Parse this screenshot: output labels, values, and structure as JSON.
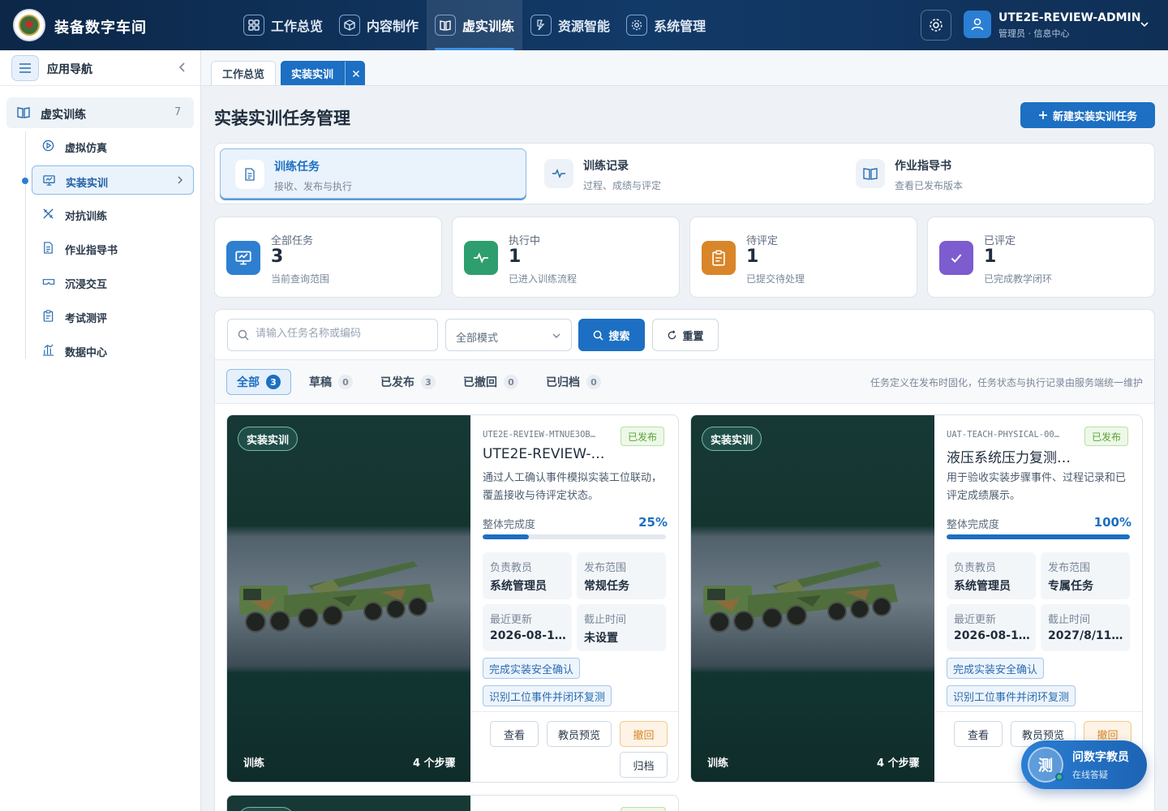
{
  "app": {
    "title": "装备数字车间"
  },
  "top_nav": [
    {
      "label": "工作总览",
      "icon": "grid-icon"
    },
    {
      "label": "内容制作",
      "icon": "cube-icon"
    },
    {
      "label": "虚实训练",
      "icon": "book-icon",
      "active": true
    },
    {
      "label": "资源智能",
      "icon": "magnet-icon"
    },
    {
      "label": "系统管理",
      "icon": "gear-icon"
    }
  ],
  "user": {
    "name": "UTE2E-REVIEW-ADMIN",
    "role": "管理员 · 信息中心"
  },
  "sidebar": {
    "title": "应用导航",
    "group": {
      "label": "虚实训练",
      "count": "7"
    },
    "items": [
      {
        "label": "虚拟仿真",
        "icon": "play-circle-icon"
      },
      {
        "label": "实装实训",
        "icon": "monitor-icon",
        "active": true
      },
      {
        "label": "对抗训练",
        "icon": "versus-icon"
      },
      {
        "label": "作业指导书",
        "icon": "document-icon"
      },
      {
        "label": "沉浸交互",
        "icon": "vr-glasses-icon"
      },
      {
        "label": "考试测评",
        "icon": "clipboard-icon"
      },
      {
        "label": "数据中心",
        "icon": "bar-chart-icon"
      }
    ]
  },
  "tabs": [
    {
      "label": "工作总览"
    },
    {
      "label": "实装实训",
      "active": true
    }
  ],
  "page": {
    "title": "实装实训任务管理",
    "new_button": "新建实装实训任务"
  },
  "modes": [
    {
      "title": "训练任务",
      "subtitle": "接收、发布与执行",
      "icon": "document-icon",
      "active": true
    },
    {
      "title": "训练记录",
      "subtitle": "过程、成绩与评定",
      "icon": "pulse-icon"
    },
    {
      "title": "作业指导书",
      "subtitle": "查看已发布版本",
      "icon": "book-icon"
    }
  ],
  "stats": [
    {
      "label": "全部任务",
      "value": "3",
      "sub": "当前查询范围",
      "color": "#2f7fd0",
      "icon": "monitor-icon"
    },
    {
      "label": "执行中",
      "value": "1",
      "sub": "已进入训练流程",
      "color": "#2e9e6e",
      "icon": "pulse-icon"
    },
    {
      "label": "待评定",
      "value": "1",
      "sub": "已提交待处理",
      "color": "#d9852a",
      "icon": "clipboard-icon"
    },
    {
      "label": "已评定",
      "value": "1",
      "sub": "已完成教学闭环",
      "color": "#7c5ccf",
      "icon": "check-icon"
    }
  ],
  "search": {
    "placeholder": "请输入任务名称或编码",
    "mode_select": "全部模式",
    "search_button": "搜索",
    "reset_button": "重置"
  },
  "filters": [
    {
      "label": "全部",
      "count": "3",
      "active": true
    },
    {
      "label": "草稿",
      "count": "0"
    },
    {
      "label": "已发布",
      "count": "3"
    },
    {
      "label": "已撤回",
      "count": "0"
    },
    {
      "label": "已归档",
      "count": "0"
    }
  ],
  "filter_note": "任务定义在发布时固化，任务状态与执行记录由服务端统一维护",
  "cards": [
    {
      "tag": "实装实训",
      "code": "UTE2E-REVIEW-MTNUE3OB…",
      "status": "已发布",
      "title": "UTE2E-REVIEW-…",
      "description": "通过人工确认事件模拟实装工位联动，覆盖接收与待评定状态。",
      "progress_label": "整体完成度",
      "progress_text": "25%",
      "progress": 0.25,
      "fields": [
        {
          "key": "负责教员",
          "value": "系统管理员"
        },
        {
          "key": "发布范围",
          "value": "常规任务"
        },
        {
          "key": "最近更新",
          "value": "2026-08-1…"
        },
        {
          "key": "截止时间",
          "value": "未设置"
        }
      ],
      "chips": [
        "完成实装安全确认",
        "识别工位事件并闭环复测"
      ],
      "image_footer_left": "训练",
      "image_footer_right": "4 个步骤",
      "actions": [
        "查看",
        "教员预览",
        "撤回",
        "归档"
      ]
    },
    {
      "tag": "实装实训",
      "code": "UAT-TEACH-PHYSICAL-00…",
      "status": "已发布",
      "title": "液压系统压力复测…",
      "description": "用于验收实装步骤事件、过程记录和已评定成绩展示。",
      "progress_label": "整体完成度",
      "progress_text": "100%",
      "progress": 1.0,
      "fields": [
        {
          "key": "负责教员",
          "value": "系统管理员"
        },
        {
          "key": "发布范围",
          "value": "专属任务"
        },
        {
          "key": "最近更新",
          "value": "2026-08-1…"
        },
        {
          "key": "截止时间",
          "value": "2027/8/11 …"
        }
      ],
      "chips": [
        "完成实装安全确认",
        "识别工位事件并闭环复测"
      ],
      "image_footer_left": "训练",
      "image_footer_right": "4 个步骤",
      "actions": [
        "查看",
        "教员预览",
        "撤回"
      ]
    }
  ],
  "assistant": {
    "avatar": "测",
    "title": "问数字教员",
    "subtitle": "在线答疑"
  }
}
